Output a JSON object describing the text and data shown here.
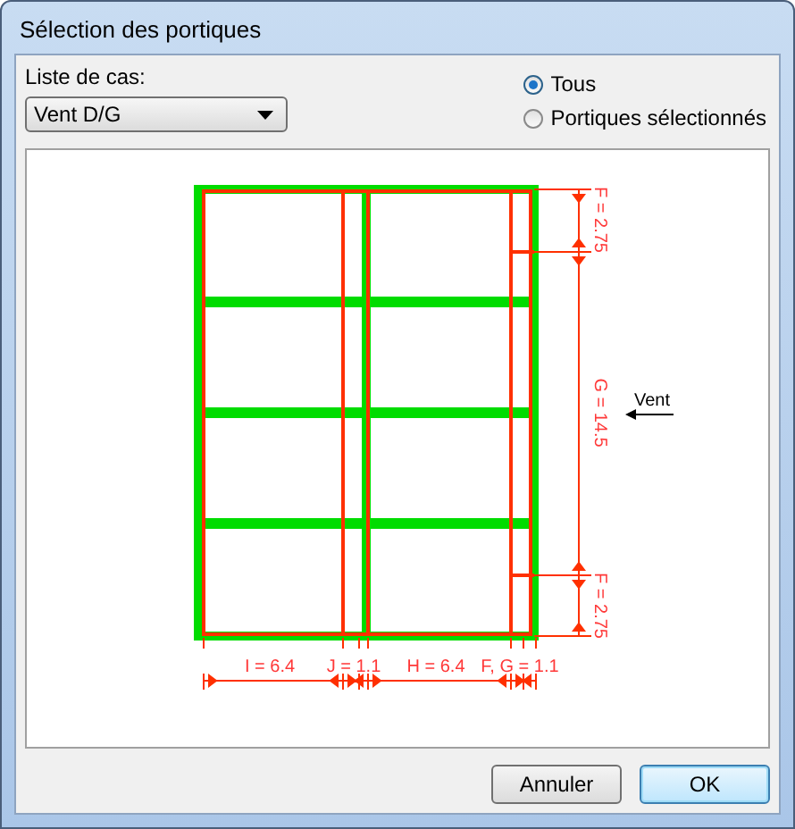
{
  "window": {
    "title": "Sélection des portiques"
  },
  "case_list": {
    "label": "Liste de cas:",
    "value": "Vent D/G"
  },
  "radios": [
    {
      "label": "Tous",
      "selected": true
    },
    {
      "label": "Portiques sélectionnés",
      "selected": false
    }
  ],
  "diagram": {
    "right_dimensions": [
      "F = 2.75",
      "G = 14.5",
      "F = 2.75"
    ],
    "bottom_dimensions": [
      "I = 6.4",
      "J = 1.1",
      "H = 6.4",
      "F, G = 1.1"
    ],
    "wind_label": "Vent"
  },
  "buttons": [
    {
      "label": "Annuler",
      "default": false
    },
    {
      "label": "OK",
      "default": true
    }
  ]
}
